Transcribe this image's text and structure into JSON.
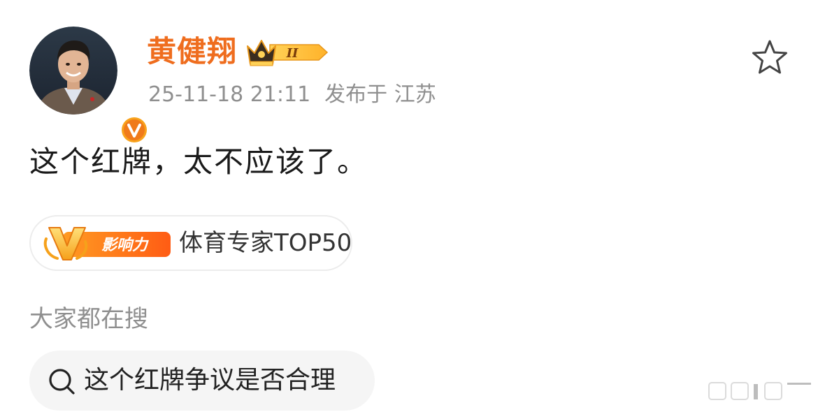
{
  "post": {
    "author": {
      "name": "黄健翔",
      "member_level": "II",
      "verified_badge": "V"
    },
    "meta": {
      "timestamp": "25-11-18 21:11",
      "location": "发布于 江苏"
    },
    "text": "这个红牌，太不应该了。",
    "influence_tag": {
      "logo_text": "影响力",
      "label": "体育专家TOP50"
    }
  },
  "search_section": {
    "title": "大家都在搜",
    "query": "这个红牌争议是否合理"
  },
  "icons": {
    "favorite": "star-outline-icon",
    "search": "search-icon",
    "crown": "crown-icon"
  },
  "colors": {
    "username": "#ef6d1e",
    "badge_orange": "#f5a623",
    "verified": "#f8a21b",
    "meta_gray": "#8f8f8f",
    "chip_bg": "#f5f5f5"
  }
}
